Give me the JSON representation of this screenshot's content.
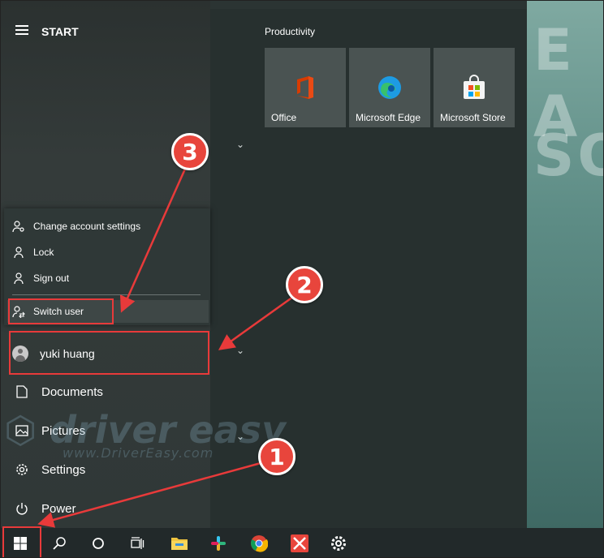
{
  "start": {
    "title": "START"
  },
  "account_menu": {
    "items": [
      {
        "label": "Change account settings",
        "icon": "person-gear-icon"
      },
      {
        "label": "Lock",
        "icon": "lock-icon"
      },
      {
        "label": "Sign out",
        "icon": "sign-out-icon"
      },
      {
        "label": "Switch user",
        "icon": "switch-user-icon"
      }
    ]
  },
  "user": {
    "name": "yuki huang"
  },
  "nav": [
    {
      "label": "Documents",
      "icon": "document-icon"
    },
    {
      "label": "Pictures",
      "icon": "picture-icon"
    },
    {
      "label": "Settings",
      "icon": "gear-icon"
    },
    {
      "label": "Power",
      "icon": "power-icon"
    }
  ],
  "tiles": {
    "group_title": "Productivity",
    "items": [
      {
        "label": "Office",
        "icon": "office-icon",
        "color": "#d83b01"
      },
      {
        "label": "Microsoft Edge",
        "icon": "edge-icon",
        "color": "#1d9be3"
      },
      {
        "label": "Microsoft Store",
        "icon": "store-icon",
        "color": "#f4f4f4"
      }
    ]
  },
  "taskbar": [
    "windows-start-icon",
    "search-icon",
    "cortana-icon",
    "task-view-icon",
    "file-explorer-icon",
    "slack-icon",
    "chrome-icon",
    "xmind-icon",
    "settings-gear-icon"
  ],
  "annotations": {
    "step1": "1",
    "step2": "2",
    "step3": "3",
    "accent": "#e83a3a"
  },
  "watermark": {
    "brand": "driver easy",
    "url": "www.DriverEasy.com"
  }
}
